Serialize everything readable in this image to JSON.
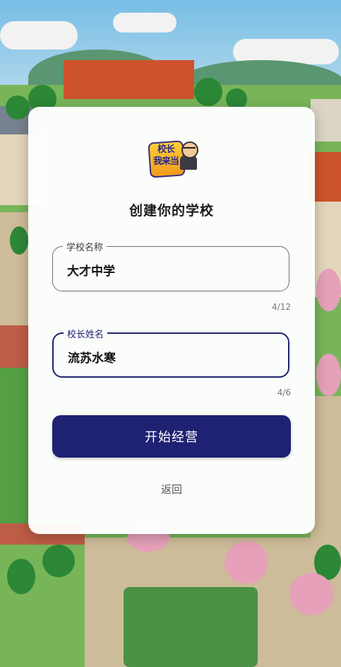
{
  "dialog": {
    "logo_text": "校长我来当",
    "title": "创建你的学校",
    "school_field": {
      "label": "学校名称",
      "value": "大才中学",
      "counter": "4/12"
    },
    "principal_field": {
      "label": "校长姓名",
      "value": "流苏水寒",
      "counter": "4/6"
    },
    "start_button": "开始经营",
    "back_link": "返回"
  },
  "colors": {
    "primary": "#1f2273",
    "active_border": "#1e2270",
    "panel": "#ffffff"
  }
}
